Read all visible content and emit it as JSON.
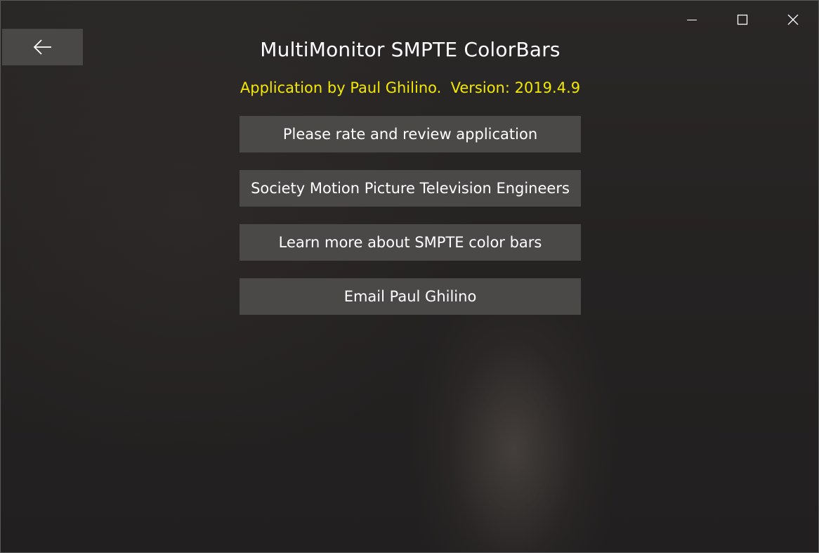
{
  "window_controls": {
    "minimize": "minimize-icon",
    "maximize": "maximize-icon",
    "close": "close-icon"
  },
  "back_button": {
    "icon": "back-arrow-icon"
  },
  "app": {
    "title": "MultiMonitor SMPTE ColorBars",
    "subtitle": "Application by Paul Ghilino.  Version: 2019.4.9"
  },
  "buttons": [
    {
      "label": "Please rate and review application"
    },
    {
      "label": "Society Motion Picture Television Engineers"
    },
    {
      "label": "Learn more about SMPTE color bars"
    },
    {
      "label": "Email Paul Ghilino"
    }
  ],
  "colors": {
    "background": "#252222",
    "button_bg": "#4b4848",
    "subtitle_text": "#f2e800",
    "title_text": "#ffffff"
  }
}
